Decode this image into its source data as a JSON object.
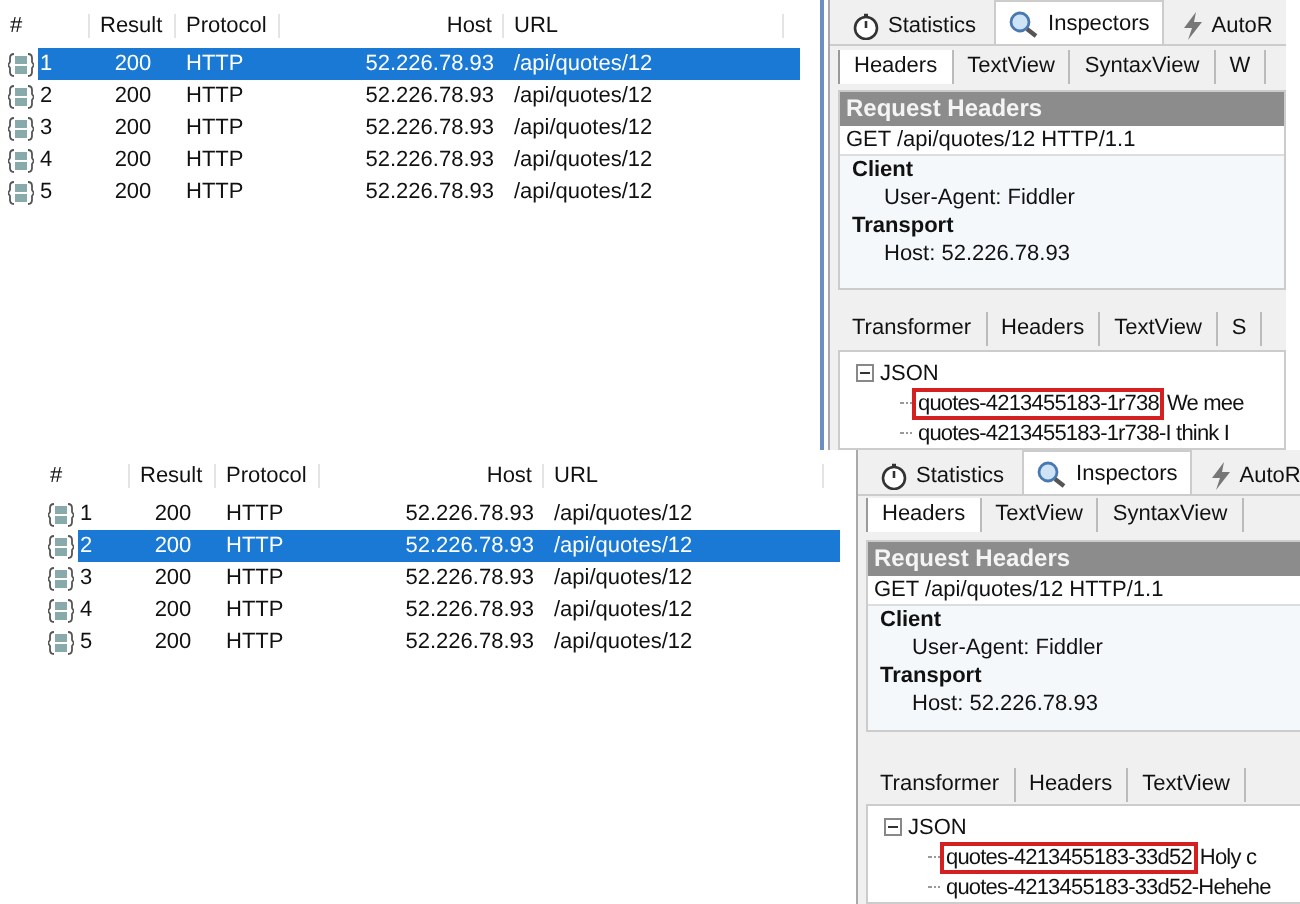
{
  "snapshots": [
    {
      "sessions": {
        "columns": [
          "#",
          "Result",
          "Protocol",
          "Host",
          "URL"
        ],
        "rows": [
          {
            "num": "1",
            "result": "200",
            "protocol": "HTTP",
            "host": "52.226.78.93",
            "url": "/api/quotes/12",
            "selected": true
          },
          {
            "num": "2",
            "result": "200",
            "protocol": "HTTP",
            "host": "52.226.78.93",
            "url": "/api/quotes/12",
            "selected": false
          },
          {
            "num": "3",
            "result": "200",
            "protocol": "HTTP",
            "host": "52.226.78.93",
            "url": "/api/quotes/12",
            "selected": false
          },
          {
            "num": "4",
            "result": "200",
            "protocol": "HTTP",
            "host": "52.226.78.93",
            "url": "/api/quotes/12",
            "selected": false
          },
          {
            "num": "5",
            "result": "200",
            "protocol": "HTTP",
            "host": "52.226.78.93",
            "url": "/api/quotes/12",
            "selected": false
          }
        ]
      },
      "inspector": {
        "top_tabs": [
          {
            "kind": "statistics",
            "label": "Statistics",
            "selected": false
          },
          {
            "kind": "inspectors",
            "label": "Inspectors",
            "selected": true
          },
          {
            "kind": "autoresponder",
            "label": "AutoR",
            "selected": false
          }
        ],
        "request_tabs": [
          {
            "label": "Headers",
            "selected": true
          },
          {
            "label": "TextView",
            "selected": false
          },
          {
            "label": "SyntaxView",
            "selected": false
          },
          {
            "label": "W",
            "selected": false
          }
        ],
        "headers_title": "Request Headers",
        "request_line": "GET /api/quotes/12 HTTP/1.1",
        "groups": [
          {
            "name": "Client",
            "items": [
              "User-Agent: Fiddler"
            ]
          },
          {
            "name": "Transport",
            "items": [
              "Host: 52.226.78.93"
            ]
          }
        ],
        "response_tabs": [
          {
            "label": "Transformer",
            "selected": false
          },
          {
            "label": "Headers",
            "selected": false
          },
          {
            "label": "TextView",
            "selected": false
          },
          {
            "label": "S",
            "selected": false
          }
        ],
        "tree": {
          "root": "JSON",
          "expanded": true,
          "children": [
            {
              "key": "quotes-4213455183-1r738",
              "value": "We mee",
              "highlighted": true
            },
            {
              "key": "quotes-4213455183-1r738-I think I",
              "highlighted": false
            }
          ]
        }
      }
    },
    {
      "sessions": {
        "columns": [
          "#",
          "Result",
          "Protocol",
          "Host",
          "URL"
        ],
        "rows": [
          {
            "num": "1",
            "result": "200",
            "protocol": "HTTP",
            "host": "52.226.78.93",
            "url": "/api/quotes/12",
            "selected": false
          },
          {
            "num": "2",
            "result": "200",
            "protocol": "HTTP",
            "host": "52.226.78.93",
            "url": "/api/quotes/12",
            "selected": true
          },
          {
            "num": "3",
            "result": "200",
            "protocol": "HTTP",
            "host": "52.226.78.93",
            "url": "/api/quotes/12",
            "selected": false
          },
          {
            "num": "4",
            "result": "200",
            "protocol": "HTTP",
            "host": "52.226.78.93",
            "url": "/api/quotes/12",
            "selected": false
          },
          {
            "num": "5",
            "result": "200",
            "protocol": "HTTP",
            "host": "52.226.78.93",
            "url": "/api/quotes/12",
            "selected": false
          }
        ]
      },
      "inspector": {
        "top_tabs": [
          {
            "kind": "statistics",
            "label": "Statistics",
            "selected": false
          },
          {
            "kind": "inspectors",
            "label": "Inspectors",
            "selected": true
          },
          {
            "kind": "autoresponder",
            "label": "AutoR",
            "selected": false
          }
        ],
        "request_tabs": [
          {
            "label": "Headers",
            "selected": true
          },
          {
            "label": "TextView",
            "selected": false
          },
          {
            "label": "SyntaxView",
            "selected": false
          }
        ],
        "headers_title": "Request Headers",
        "request_line": "GET /api/quotes/12 HTTP/1.1",
        "groups": [
          {
            "name": "Client",
            "items": [
              "User-Agent: Fiddler"
            ]
          },
          {
            "name": "Transport",
            "items": [
              "Host: 52.226.78.93"
            ]
          }
        ],
        "response_tabs": [
          {
            "label": "Transformer",
            "selected": false
          },
          {
            "label": "Headers",
            "selected": false
          },
          {
            "label": "TextView",
            "selected": false
          }
        ],
        "tree": {
          "root": "JSON",
          "expanded": true,
          "children": [
            {
              "key": "quotes-4213455183-33d52",
              "value": "Holy c",
              "highlighted": true
            },
            {
              "key": "quotes-4213455183-33d52-Hehehe",
              "highlighted": false
            }
          ]
        }
      }
    }
  ]
}
